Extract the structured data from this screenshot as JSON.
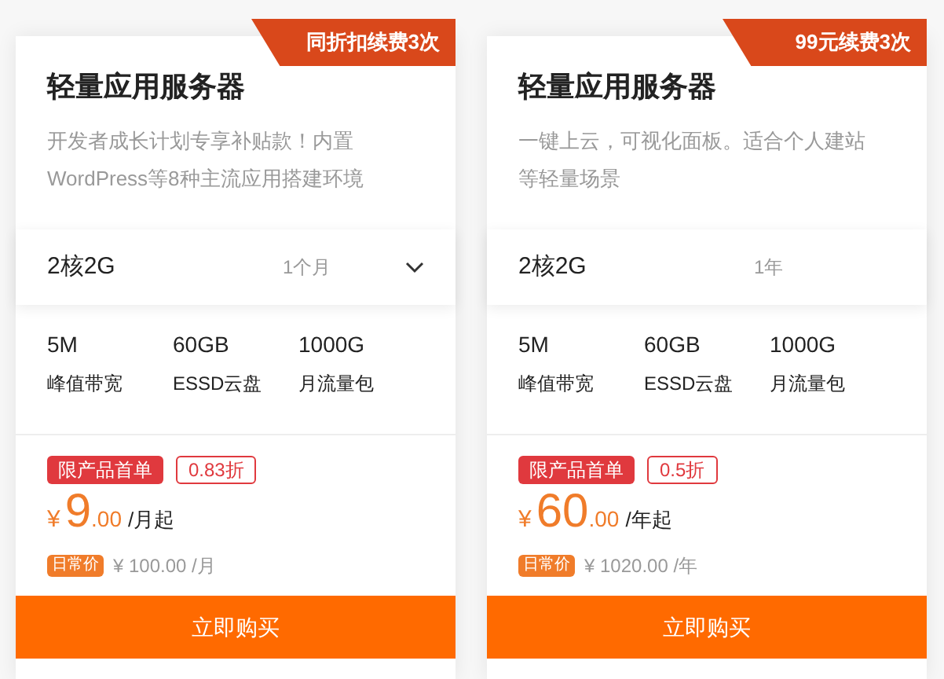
{
  "cards": [
    {
      "ribbon": "同折扣续费3次",
      "title": "轻量应用服务器",
      "description": "开发者成长计划专享补贴款！内置WordPress等8种主流应用搭建环境",
      "config": {
        "spec": "2核2G",
        "duration": "1个月",
        "dropdown": true
      },
      "specs": [
        {
          "value": "5M",
          "label": "峰值带宽"
        },
        {
          "value": "60GB",
          "label": "ESSD云盘"
        },
        {
          "value": "1000G",
          "label": "月流量包"
        }
      ],
      "promo_tag": "限产品首单",
      "discount": "0.83折",
      "price": {
        "currency": "¥",
        "integer": "9",
        "decimal": ".00",
        "unit": "/月起"
      },
      "regular_badge": "日常价",
      "regular_price": "¥ 100.00 /月",
      "button": "立即购买"
    },
    {
      "ribbon": "99元续费3次",
      "title": "轻量应用服务器",
      "description": "一键上云，可视化面板。适合个人建站等轻量场景",
      "config": {
        "spec": "2核2G",
        "duration": "1年",
        "dropdown": false
      },
      "specs": [
        {
          "value": "5M",
          "label": "峰值带宽"
        },
        {
          "value": "60GB",
          "label": "ESSD云盘"
        },
        {
          "value": "1000G",
          "label": "月流量包"
        }
      ],
      "promo_tag": "限产品首单",
      "discount": "0.5折",
      "price": {
        "currency": "¥",
        "integer": "60",
        "decimal": ".00",
        "unit": "/年起"
      },
      "regular_badge": "日常价",
      "regular_price": "¥ 1020.00 /年",
      "button": "立即购买"
    }
  ]
}
